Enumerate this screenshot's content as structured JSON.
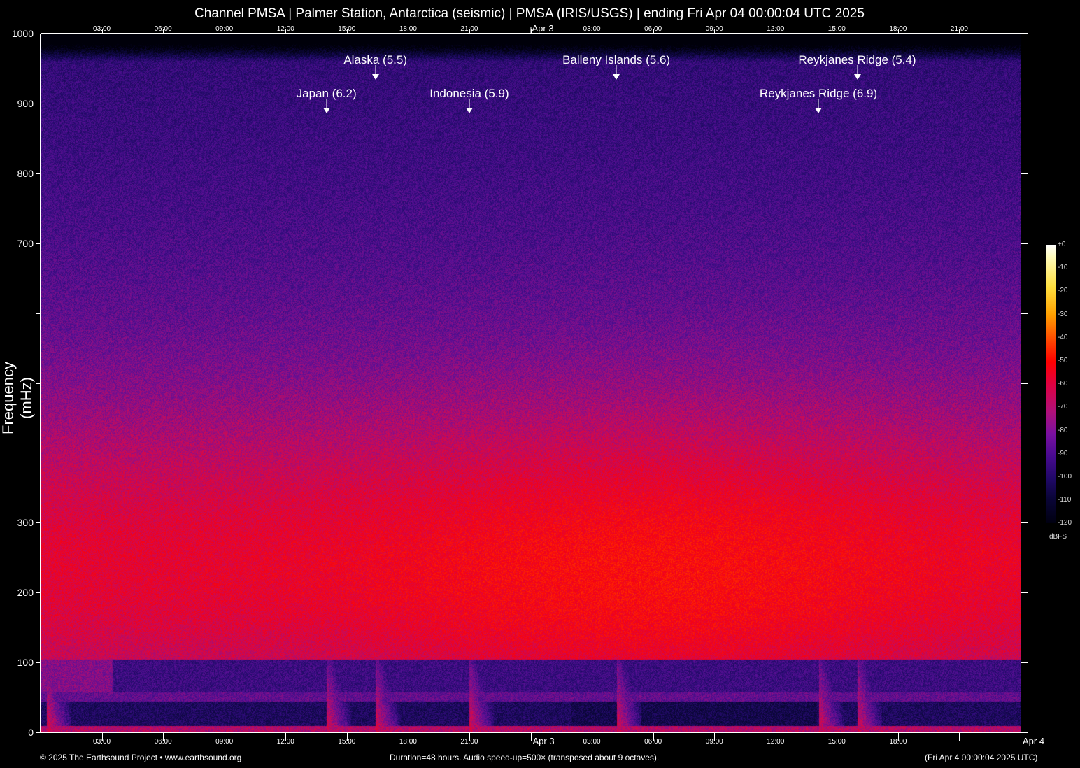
{
  "title": "Channel PMSA | Palmer Station, Antarctica (seismic) | PMSA (IRIS/USGS) | ending Fri Apr 04 00:00:04 UTC 2025",
  "footer": {
    "copyright": "© 2025 The Earthsound Project • www.earthsound.org",
    "duration": "Duration=48 hours. Audio speed-up=500× (transposed about 9 octaves).",
    "end_time": "(Fri Apr  4 00:00:04 2025 UTC)"
  },
  "chart_data": {
    "type": "heatmap",
    "title": "Channel PMSA | Palmer Station, Antarctica (seismic) | PMSA (IRIS/USGS) | ending Fri Apr 04 00:00:04 UTC 2025",
    "ylabel": "Frequency (mHz)",
    "xlabel": "",
    "ylim": [
      0,
      1000
    ],
    "xlim_hours": [
      0,
      48
    ],
    "y_ticks": [
      0,
      100,
      200,
      300,
      400,
      500,
      600,
      700,
      800,
      900,
      1000
    ],
    "y_tick_labels": [
      "0",
      "100",
      "200",
      "300",
      "",
      "",
      "",
      "700",
      "800",
      "900",
      "1000"
    ],
    "x_ticks_top": [
      "03:00",
      "06:00",
      "09:00",
      "12:00",
      "15:00",
      "18:00",
      "21:00",
      "Apr  3",
      "03:00",
      "06:00",
      "09:00",
      "12:00",
      "15:00",
      "18:00",
      "21:00"
    ],
    "x_ticks_bottom": [
      "03:00",
      "06:00",
      "09:00",
      "12:00",
      "15:00",
      "18:00",
      "21:00",
      "Apr  3",
      "03:00",
      "06:00",
      "09:00",
      "12:00",
      "15:00",
      "18:00",
      "",
      "Apr  4"
    ],
    "colorbar": {
      "unit": "dBFS",
      "range": [
        -120,
        0
      ],
      "tick_labels": [
        "+0",
        "-10",
        "-20",
        "-30",
        "-40",
        "-50",
        "-60",
        "-70",
        "-80",
        "-90",
        "-100",
        "-110",
        "-120"
      ]
    },
    "annotations": [
      {
        "label": "Japan (6.2)",
        "hour": 14.0,
        "row": 2
      },
      {
        "label": "Alaska (5.5)",
        "hour": 16.4,
        "row": 1
      },
      {
        "label": "Indonesia (5.9)",
        "hour": 21.0,
        "row": 2
      },
      {
        "label": "Balleny Islands (5.6)",
        "hour": 28.2,
        "row": 1
      },
      {
        "label": "Reykjanes Ridge (6.9)",
        "hour": 38.1,
        "row": 2
      },
      {
        "label": "Reykjanes Ridge (5.4)",
        "hour": 40.0,
        "row": 1
      }
    ]
  }
}
